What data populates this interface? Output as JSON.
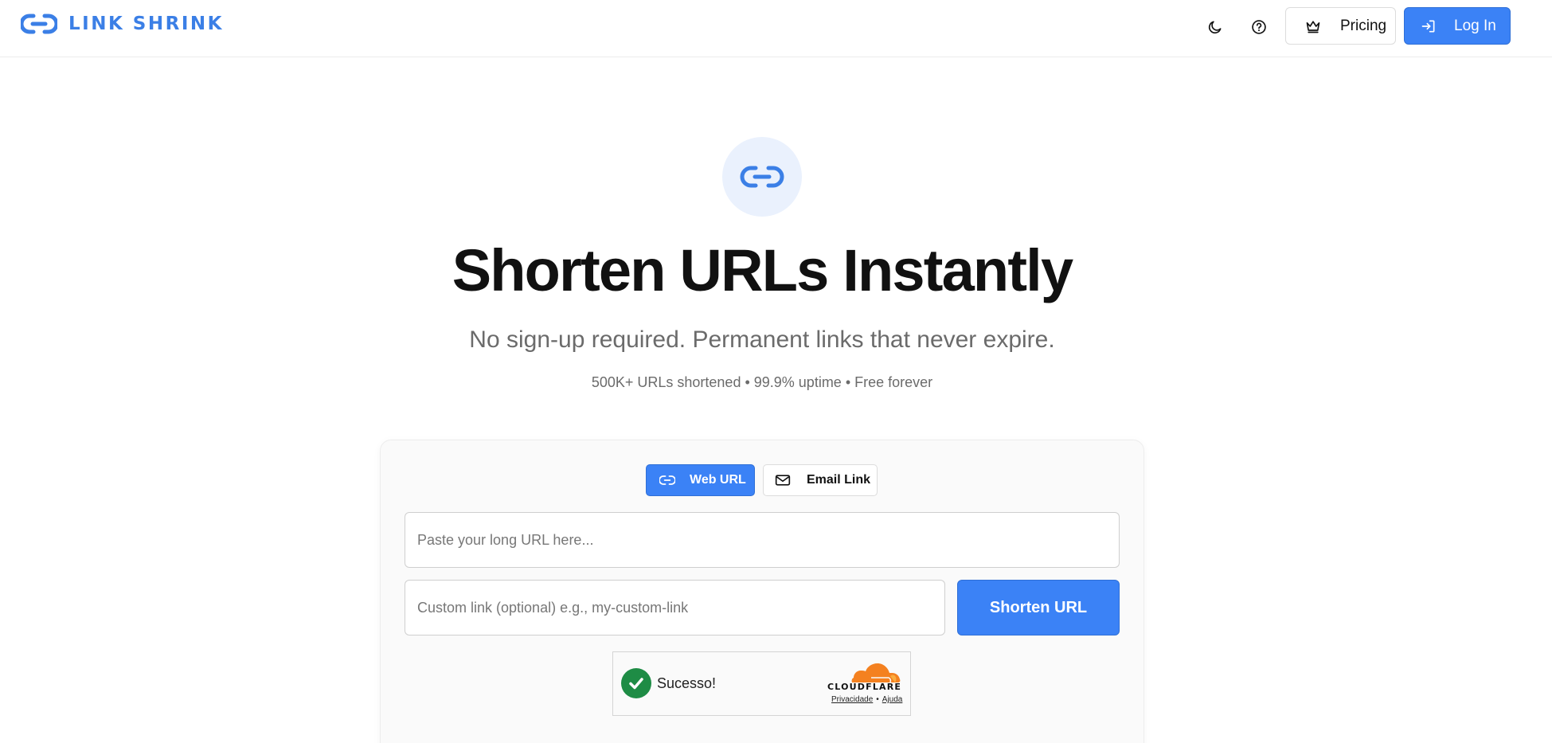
{
  "header": {
    "brand": "LINK SHRINK",
    "pricing_label": "Pricing",
    "login_label": "Log In"
  },
  "hero": {
    "title": "Shorten URLs Instantly",
    "subtitle": "No sign-up required. Permanent links that never expire.",
    "stats": "500K+ URLs shortened • 99.9% uptime • Free forever"
  },
  "form": {
    "tabs": [
      {
        "label": "Web URL",
        "icon": "link-icon",
        "active": true
      },
      {
        "label": "Email Link",
        "icon": "mail-icon",
        "active": false
      }
    ],
    "url_placeholder": "Paste your long URL here...",
    "custom_placeholder": "Custom link (optional) e.g., my-custom-link",
    "submit_label": "Shorten URL"
  },
  "captcha": {
    "status": "Sucesso!",
    "provider": "CLOUDFLARE",
    "privacy_label": "Privacidade",
    "separator": "•",
    "help_label": "Ajuda"
  },
  "colors": {
    "accent": "#3b82f6",
    "brand": "#3b7fe6",
    "hero_icon_bg": "#eaf1fd",
    "success": "#1e8c45",
    "cloudflare_orange": "#f48120"
  }
}
